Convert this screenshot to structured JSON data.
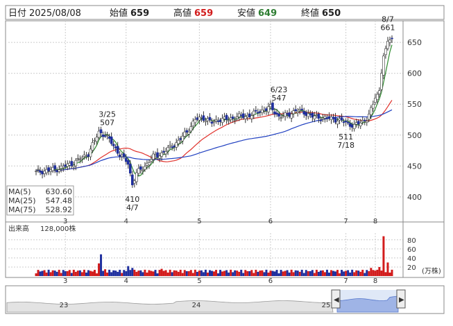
{
  "header": {
    "date_label": "日付",
    "date": "2025/08/08",
    "open_label": "始値",
    "open": "659",
    "high_label": "高値",
    "high": "659",
    "low_label": "安値",
    "low": "649",
    "close_label": "終値",
    "close": "650"
  },
  "colors": {
    "up": "#ffffff",
    "down": "#1f2f9e",
    "ma5": "#2e8b2e",
    "ma25": "#e0302a",
    "ma75": "#1f3fc0",
    "vol_up": "#d21c1c",
    "vol_down": "#1f2f9e",
    "accent_high": "#d21c1c",
    "accent_low": "#2e7d32"
  },
  "chart_data": {
    "type": "candlestick",
    "x_ticks": [
      "3",
      "4",
      "5",
      "6",
      "7",
      "8"
    ],
    "y_ticks": [
      400,
      450,
      500,
      550,
      600,
      650
    ],
    "ylim": [
      365,
      685
    ],
    "legend": [
      {
        "label": "MA(5)",
        "value": "630.60"
      },
      {
        "label": "MA(25)",
        "value": "547.48"
      },
      {
        "label": "MA(75)",
        "value": "528.92"
      }
    ],
    "annotations": [
      {
        "date": "3/25",
        "value": "507"
      },
      {
        "date": "4/7",
        "value": "410"
      },
      {
        "date": "6/23",
        "value": "547"
      },
      {
        "date": "7/18",
        "value": "511"
      },
      {
        "date": "8/7",
        "value": "661"
      }
    ],
    "volume": {
      "title": "出来高",
      "last": "128,000株",
      "unit": "(万株)",
      "ticks": [
        20,
        40,
        60,
        80
      ],
      "ylim": [
        0,
        95
      ]
    },
    "navigator": {
      "labels": [
        "23",
        "24",
        "25"
      ]
    }
  }
}
